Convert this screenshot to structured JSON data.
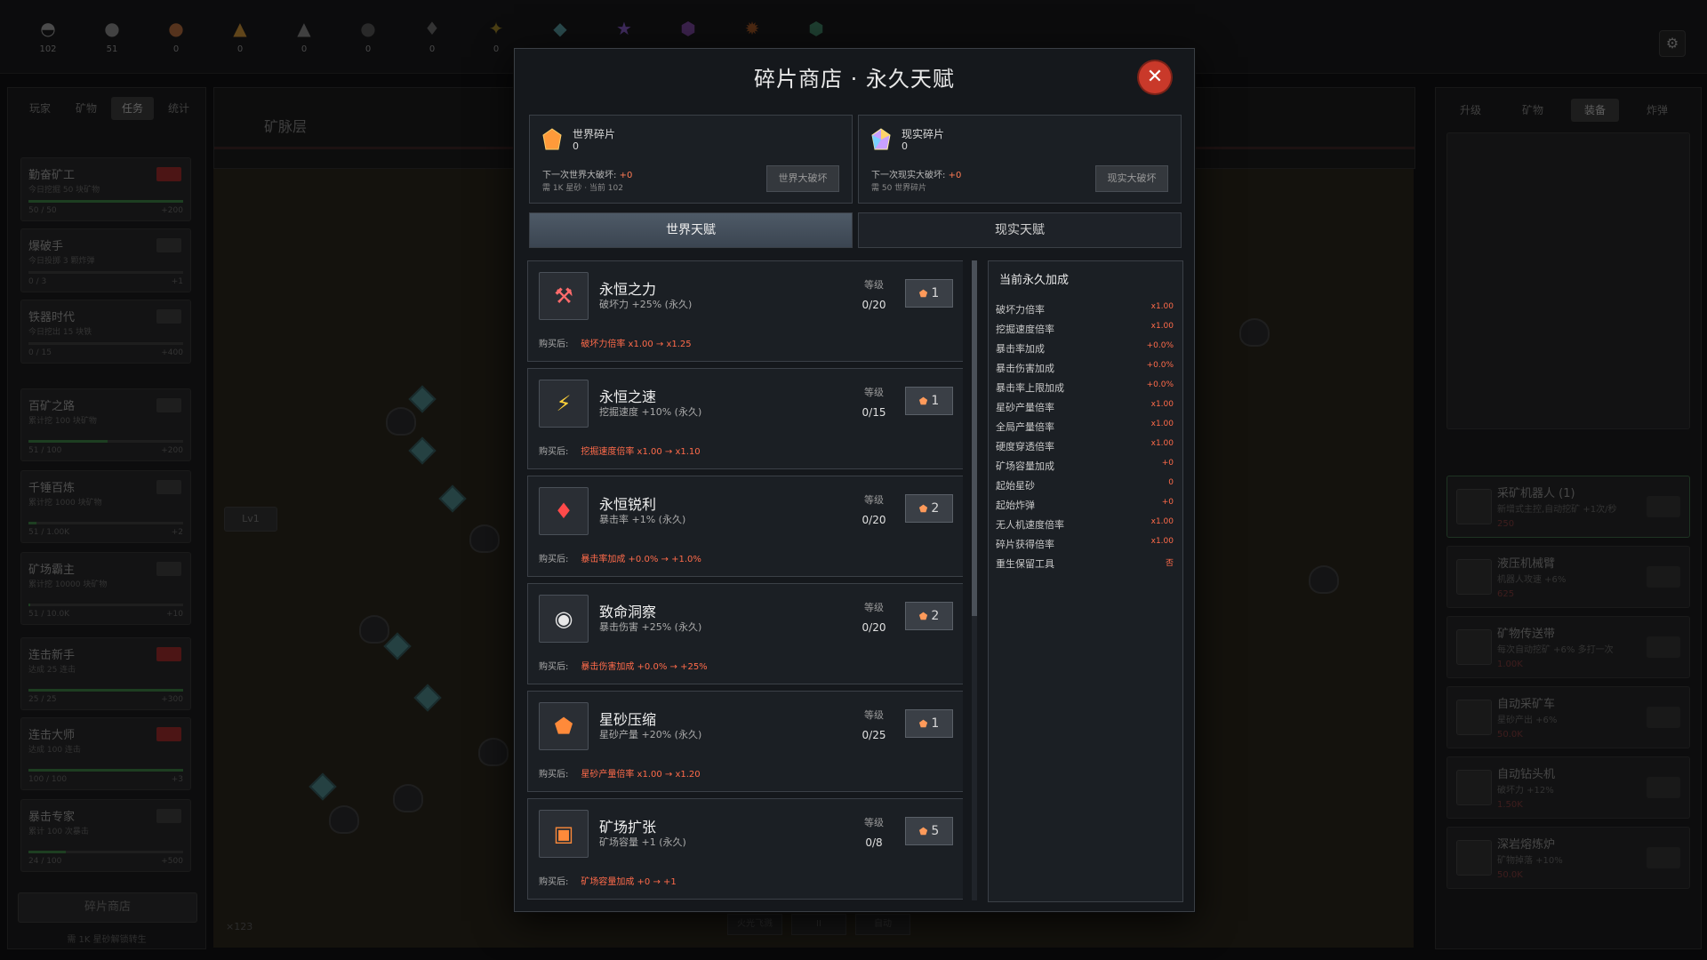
{
  "topbar": {
    "resources": [
      {
        "icon": "hat-icon",
        "glyph": "◓",
        "value": "102",
        "color": "#6c6c6c"
      },
      {
        "icon": "rock-icon",
        "glyph": "●",
        "value": "51",
        "color": "#5f5f5f"
      },
      {
        "icon": "copper-ore-icon",
        "glyph": "●",
        "value": "0",
        "color": "#7a4a2a"
      },
      {
        "icon": "gold-ore-icon",
        "glyph": "▲",
        "value": "0",
        "color": "#8a6326"
      },
      {
        "icon": "spire-icon",
        "glyph": "▲",
        "value": "0",
        "color": "#5c5c5c"
      },
      {
        "icon": "dark-ore-icon",
        "glyph": "●",
        "value": "0",
        "color": "#3b3b3b"
      },
      {
        "icon": "crystal-cluster-icon",
        "glyph": "♦",
        "value": "0",
        "color": "#4a4a4a"
      },
      {
        "icon": "gold-flakes-icon",
        "glyph": "✦",
        "value": "0",
        "color": "#6a5a1e"
      },
      {
        "icon": "diamond-icon",
        "glyph": "◆",
        "value": "",
        "color": "#3d6b6f"
      },
      {
        "icon": "star-icon",
        "glyph": "★",
        "value": "",
        "color": "#5b3e86"
      },
      {
        "icon": "void-gem-icon",
        "glyph": "⬢",
        "value": "",
        "color": "#55316e"
      },
      {
        "icon": "fire-gem-icon",
        "glyph": "✹",
        "value": "",
        "color": "#6e3b1a"
      },
      {
        "icon": "emerald-icon",
        "glyph": "⬢",
        "value": "",
        "color": "#2b5a45"
      }
    ]
  },
  "left": {
    "tabs": [
      "玩家",
      "矿物",
      "任务",
      "统计"
    ],
    "active_tab": "任务",
    "cards": [
      {
        "title": "勤奋矿工",
        "desc": "今日挖掘 50 块矿物",
        "progress": "50 / 50",
        "reward": "+200",
        "red": true,
        "fill": 1.0
      },
      {
        "title": "爆破手",
        "desc": "今日投掷 3 颗炸弹",
        "progress": "0 / 3",
        "reward": "+1",
        "red": false,
        "fill": 0
      },
      {
        "title": "铁器时代",
        "desc": "今日挖出 15 块铁",
        "progress": "0 / 15",
        "reward": "+400",
        "red": false,
        "fill": 0
      },
      {
        "title": "百矿之路",
        "desc": "累计挖 100 块矿物",
        "progress": "51 / 100",
        "reward": "+200",
        "red": false,
        "fill": 0.51
      },
      {
        "title": "千锤百炼",
        "desc": "累计挖 1000 块矿物",
        "progress": "51 / 1.00K",
        "reward": "+2",
        "red": false,
        "fill": 0.05
      },
      {
        "title": "矿场霸主",
        "desc": "累计挖 10000 块矿物",
        "progress": "51 / 10.0K",
        "reward": "+10",
        "red": false,
        "fill": 0.01
      },
      {
        "title": "连击新手",
        "desc": "达成 25 连击",
        "progress": "25 / 25",
        "reward": "+300",
        "red": true,
        "fill": 1.0
      },
      {
        "title": "连击大师",
        "desc": "达成 100 连击",
        "progress": "100 / 100",
        "reward": "+3",
        "red": true,
        "fill": 1.0
      },
      {
        "title": "暴击专家",
        "desc": "累计 100 次暴击",
        "progress": "24 / 100",
        "reward": "+500",
        "red": false,
        "fill": 0.24
      }
    ],
    "shop_button": "碎片商店",
    "shop_hint": "需 1K 星砂解锁转生"
  },
  "center": {
    "layer_name": "矿脉层",
    "level_tag": "Lv1",
    "combo": "×123",
    "bottom_buttons": [
      "火光飞溅",
      "II",
      "自动"
    ]
  },
  "right": {
    "tabs": [
      "升级",
      "矿物",
      "装备",
      "炸弹"
    ],
    "active_tab": "装备",
    "cards": [
      {
        "title": "采矿机器人 (1)",
        "desc": "新增式主控,自动挖矿 +1次/秒",
        "cost": "250"
      },
      {
        "title": "液压机械臂",
        "desc": "机器人攻速 +6%",
        "cost": "625"
      },
      {
        "title": "矿物传送带",
        "desc": "每次自动挖矿 +6% 多打一次",
        "cost": "1.00K"
      },
      {
        "title": "自动采矿车",
        "desc": "星砂产出 +6%",
        "cost": "50.0K"
      },
      {
        "title": "自动钻头机",
        "desc": "破坏力 +12%",
        "cost": "1.50K"
      },
      {
        "title": "深岩熔炼炉",
        "desc": "矿物掉落 +10%",
        "cost": "50.0K"
      }
    ]
  },
  "modal": {
    "title": "碎片商店 · 永久天赋",
    "world": {
      "name": "世界碎片",
      "count": "0",
      "next_label": "下一次世界大破坏:",
      "next_value": "+0",
      "requirement": "需 1K 星砂 · 当前 102",
      "button": "世界大破坏"
    },
    "reality": {
      "name": "现实碎片",
      "count": "0",
      "next_label": "下一次现实大破坏:",
      "next_value": "+0",
      "requirement": "需 50 世界碎片",
      "button": "现实大破坏"
    },
    "tabs": [
      "世界天赋",
      "现实天赋"
    ],
    "level_label": "等级",
    "after_buy_label": "购买后:",
    "talents": [
      {
        "icon": "hammer-icon",
        "glyph": "⚒",
        "glyph_color": "#ff6b6b",
        "name": "永恒之力",
        "desc": "破坏力 +25% (永久)",
        "level": "0/20",
        "cost": "1",
        "after": "破坏力倍率 x1.00 → x1.25"
      },
      {
        "icon": "lightning-icon",
        "glyph": "⚡",
        "glyph_color": "#ffd23a",
        "name": "永恒之速",
        "desc": "挖掘速度 +10% (永久)",
        "level": "0/15",
        "cost": "1",
        "after": "挖掘速度倍率 x1.00 → x1.10"
      },
      {
        "icon": "sword-icon",
        "glyph": "♦",
        "glyph_color": "#ff4a4a",
        "name": "永恒锐利",
        "desc": "暴击率 +1% (永久)",
        "level": "0/20",
        "cost": "2",
        "after": "暴击率加成 +0.0% → +1.0%"
      },
      {
        "icon": "eye-icon",
        "glyph": "◉",
        "glyph_color": "#e8e8e8",
        "name": "致命洞察",
        "desc": "暴击伤害 +25% (永久)",
        "level": "0/20",
        "cost": "2",
        "after": "暴击伤害加成 +0.0% → +25%"
      },
      {
        "icon": "orange-gem-icon",
        "glyph": "⬟",
        "glyph_color": "#ff8a3a",
        "name": "星砂压缩",
        "desc": "星砂产量 +20% (永久)",
        "level": "0/25",
        "cost": "1",
        "after": "星砂产量倍率 x1.00 → x1.20"
      },
      {
        "icon": "capacity-icon",
        "glyph": "▣",
        "glyph_color": "#ff8a3a",
        "name": "矿场扩张",
        "desc": "矿场容量 +1 (永久)",
        "level": "0/8",
        "cost": "5",
        "after": "矿场容量加成 +0 → +1"
      }
    ],
    "bonus": {
      "heading": "当前永久加成",
      "rows": [
        {
          "k": "破坏力倍率",
          "v": "x1.00"
        },
        {
          "k": "挖掘速度倍率",
          "v": "x1.00"
        },
        {
          "k": "暴击率加成",
          "v": "+0.0%"
        },
        {
          "k": "暴击伤害加成",
          "v": "+0.0%"
        },
        {
          "k": "暴击率上限加成",
          "v": "+0.0%"
        },
        {
          "k": "星砂产量倍率",
          "v": "x1.00"
        },
        {
          "k": "全局产量倍率",
          "v": "x1.00"
        },
        {
          "k": "硬度穿透倍率",
          "v": "x1.00"
        },
        {
          "k": "矿场容量加成",
          "v": "+0"
        },
        {
          "k": "起始星砂",
          "v": "0"
        },
        {
          "k": "起始炸弹",
          "v": "+0"
        },
        {
          "k": "无人机速度倍率",
          "v": "x1.00"
        },
        {
          "k": "碎片获得倍率",
          "v": "x1.00"
        },
        {
          "k": "重生保留工具",
          "v": "否"
        }
      ]
    }
  }
}
